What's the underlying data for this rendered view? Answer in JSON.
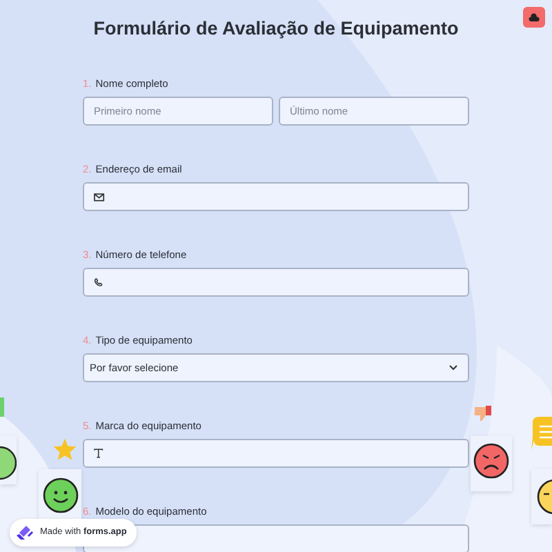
{
  "title": "Formulário de Avaliação de Equipamento",
  "questions": [
    {
      "number": "1.",
      "label": "Nome completo",
      "kind": "name",
      "placeholders": [
        "Primeiro nome",
        "Último nome"
      ]
    },
    {
      "number": "2.",
      "label": "Endereço de email",
      "kind": "email"
    },
    {
      "number": "3.",
      "label": "Número de telefone",
      "kind": "phone"
    },
    {
      "number": "4.",
      "label": "Tipo de equipamento",
      "kind": "select",
      "value": "Por favor selecione"
    },
    {
      "number": "5.",
      "label": "Marca do equipamento",
      "kind": "text"
    },
    {
      "number": "6.",
      "label": "Modelo do equipamento",
      "kind": "text"
    }
  ],
  "badge": {
    "text": "Made with",
    "brand": "forms.app"
  }
}
